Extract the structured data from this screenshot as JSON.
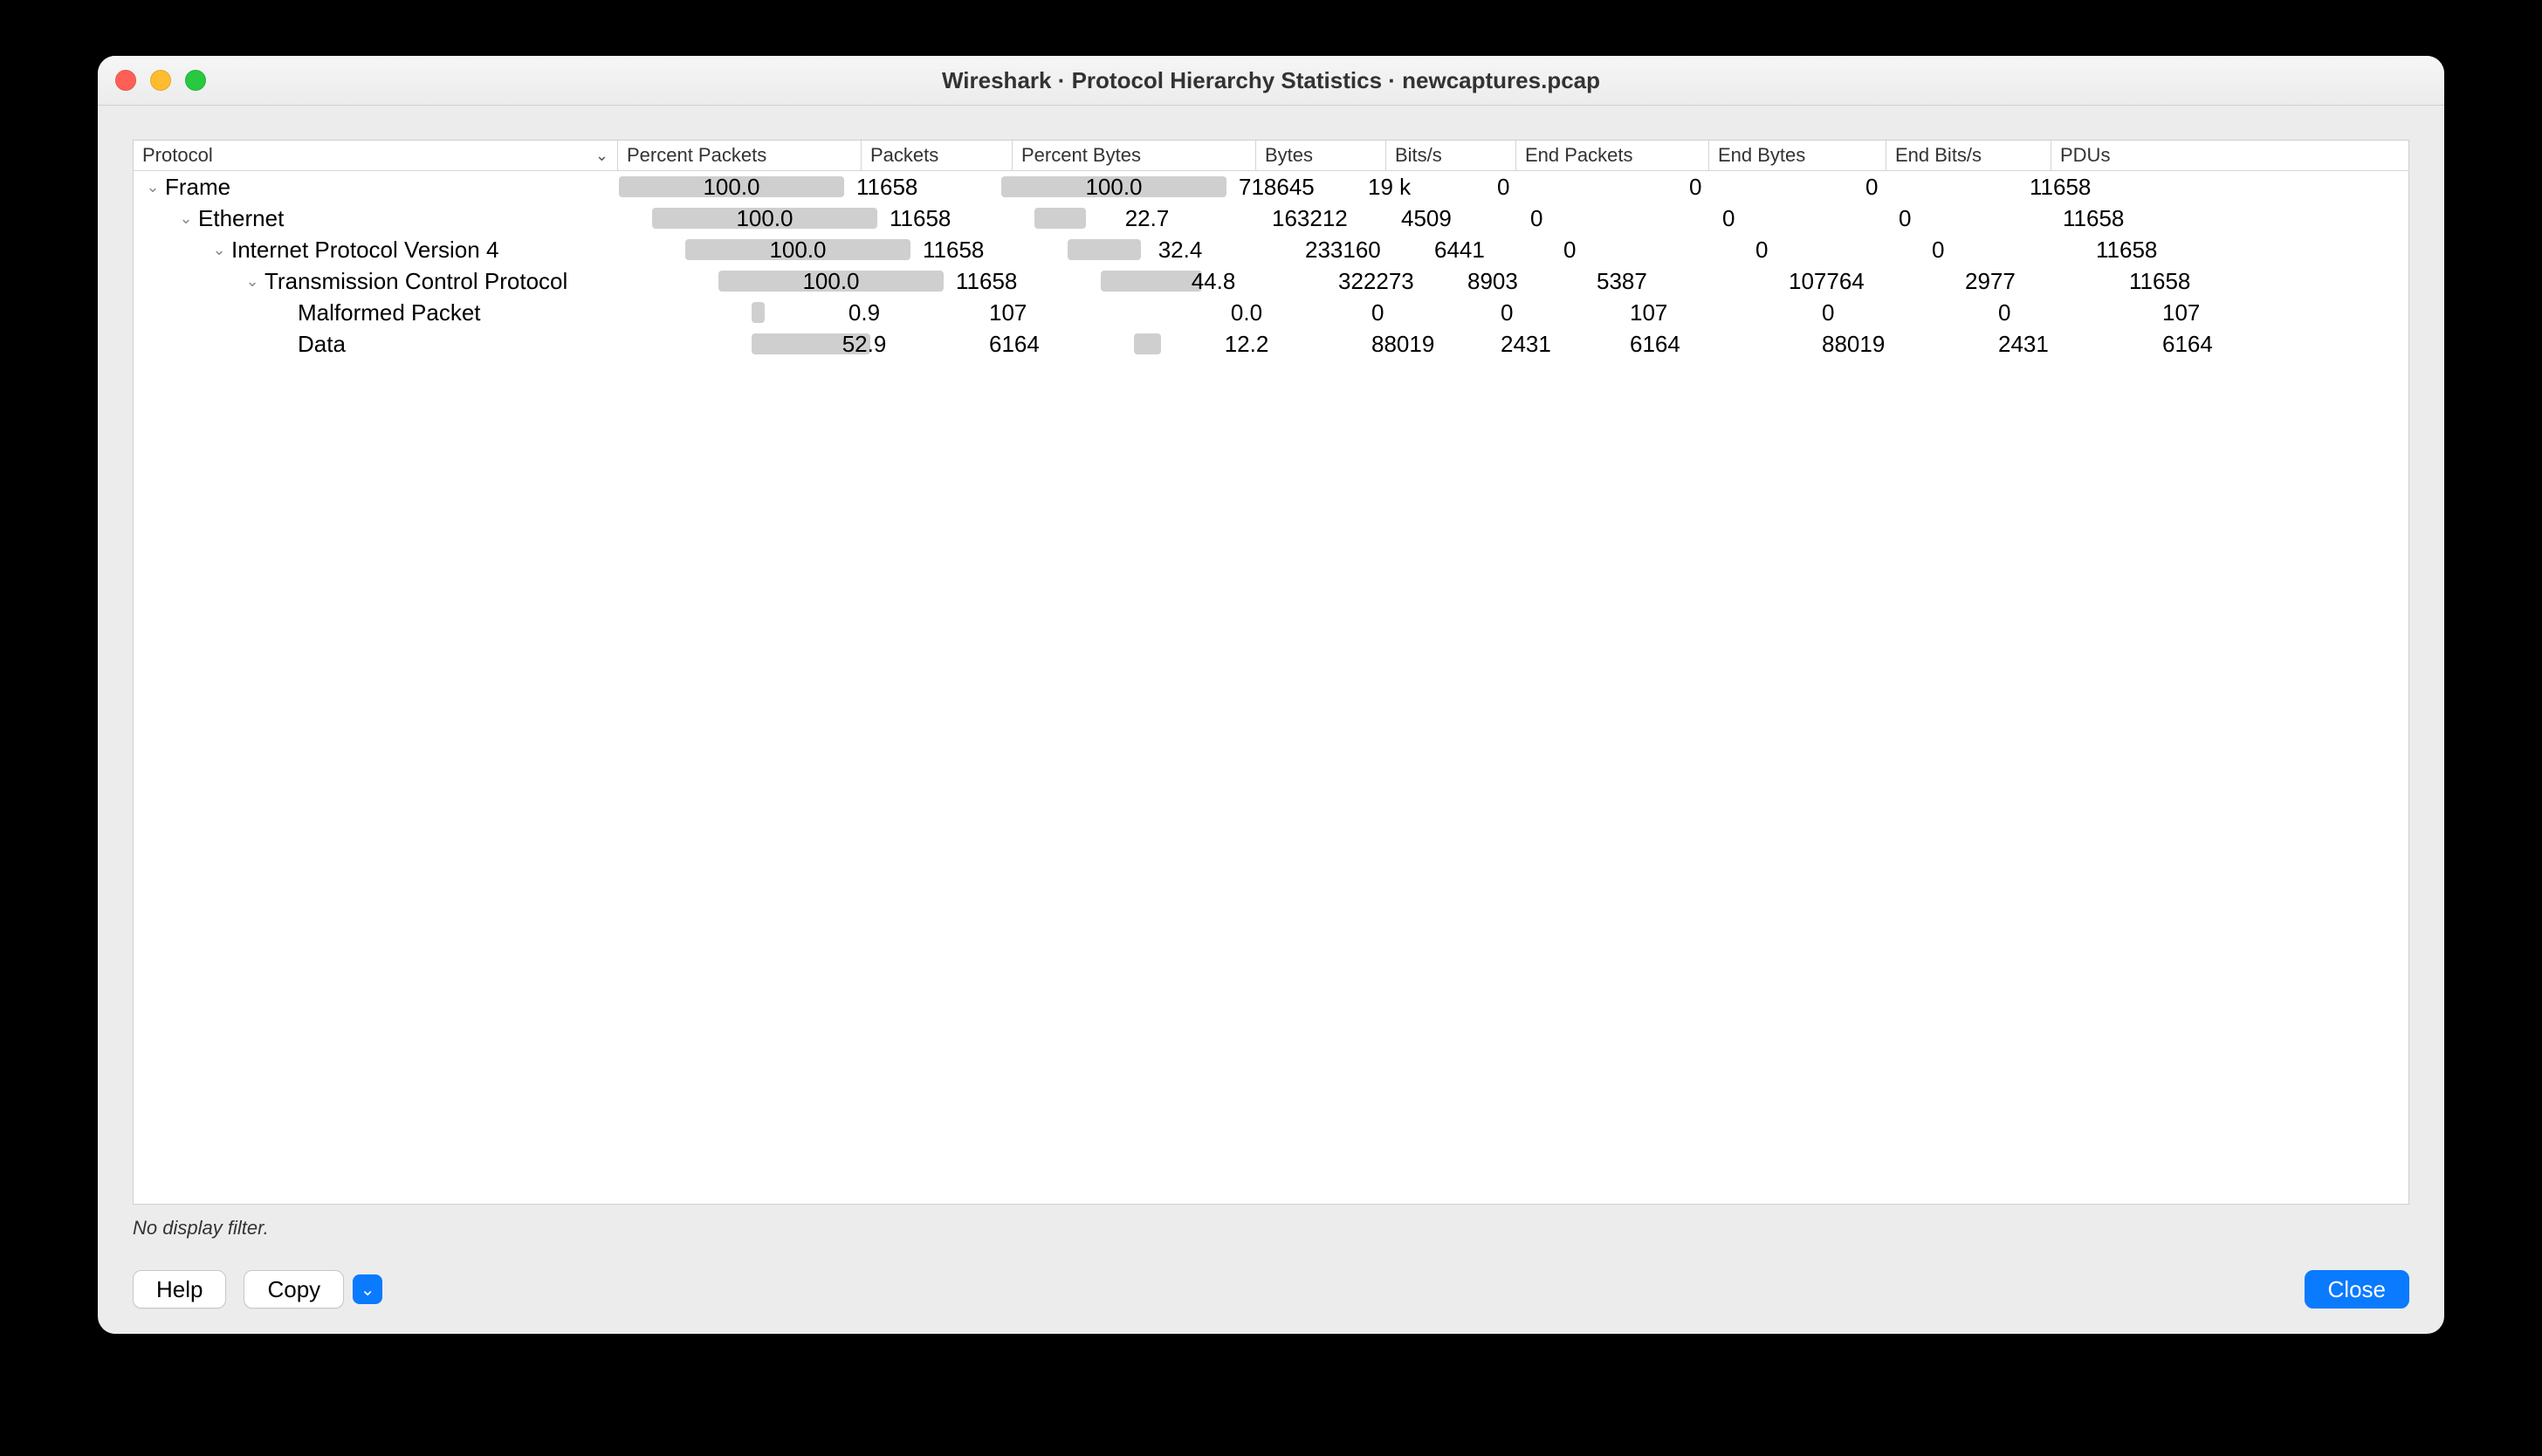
{
  "window": {
    "title": "Wireshark · Protocol Hierarchy Statistics · newcaptures.pcap"
  },
  "columns": [
    "Protocol",
    "Percent Packets",
    "Packets",
    "Percent Bytes",
    "Bytes",
    "Bits/s",
    "End Packets",
    "End Bytes",
    "End Bits/s",
    "PDUs"
  ],
  "rows": [
    {
      "indent": 0,
      "expander": true,
      "name": "Frame",
      "percent_packets": "100.0",
      "percent_packets_bar": 100,
      "packets": "11658",
      "percent_bytes": "100.0",
      "percent_bytes_bar": 100,
      "bytes": "718645",
      "bits_s": "19 k",
      "end_packets": "0",
      "end_bytes": "0",
      "end_bits_s": "0",
      "pdus": "11658"
    },
    {
      "indent": 1,
      "expander": true,
      "name": "Ethernet",
      "percent_packets": "100.0",
      "percent_packets_bar": 100,
      "packets": "11658",
      "percent_bytes": "22.7",
      "percent_bytes_bar": 22.7,
      "bytes": "163212",
      "bits_s": "4509",
      "end_packets": "0",
      "end_bytes": "0",
      "end_bits_s": "0",
      "pdus": "11658"
    },
    {
      "indent": 2,
      "expander": true,
      "name": "Internet Protocol Version 4",
      "percent_packets": "100.0",
      "percent_packets_bar": 100,
      "packets": "11658",
      "percent_bytes": "32.4",
      "percent_bytes_bar": 32.4,
      "bytes": "233160",
      "bits_s": "6441",
      "end_packets": "0",
      "end_bytes": "0",
      "end_bits_s": "0",
      "pdus": "11658"
    },
    {
      "indent": 3,
      "expander": true,
      "name": "Transmission Control Protocol",
      "percent_packets": "100.0",
      "percent_packets_bar": 100,
      "packets": "11658",
      "percent_bytes": "44.8",
      "percent_bytes_bar": 44.8,
      "bytes": "322273",
      "bits_s": "8903",
      "end_packets": "5387",
      "end_bytes": "107764",
      "end_bits_s": "2977",
      "pdus": "11658"
    },
    {
      "indent": 4,
      "expander": false,
      "name": "Malformed Packet",
      "percent_packets": "0.9",
      "percent_packets_bar": 0.9,
      "packets": "107",
      "percent_bytes": "0.0",
      "percent_bytes_bar": 0,
      "bytes": "0",
      "bits_s": "0",
      "end_packets": "107",
      "end_bytes": "0",
      "end_bits_s": "0",
      "pdus": "107"
    },
    {
      "indent": 4,
      "expander": false,
      "name": "Data",
      "percent_packets": "52.9",
      "percent_packets_bar": 52.9,
      "packets": "6164",
      "percent_bytes": "12.2",
      "percent_bytes_bar": 12.2,
      "bytes": "88019",
      "bits_s": "2431",
      "end_packets": "6164",
      "end_bytes": "88019",
      "end_bits_s": "2431",
      "pdus": "6164"
    }
  ],
  "status": "No display filter.",
  "buttons": {
    "help": "Help",
    "copy": "Copy",
    "close": "Close"
  }
}
